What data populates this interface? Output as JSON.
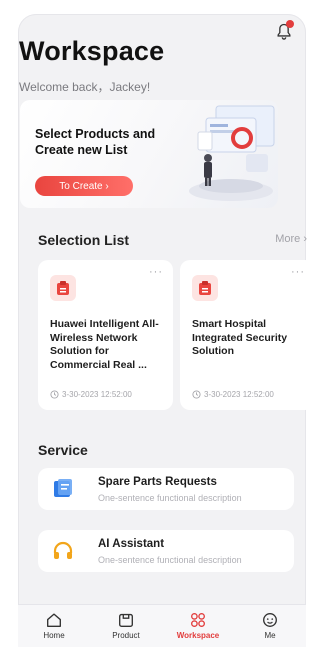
{
  "header": {
    "title": "Workspace",
    "subtitle": "Welcome back，Jackey!"
  },
  "hero": {
    "text": "Select Products and Create new List",
    "button_label": "To Create ›"
  },
  "selection": {
    "title": "Selection List",
    "more_label": "More ›",
    "cards": [
      {
        "title": "Huawei Intelligent All-Wireless Network Solution for Commercial Real ...",
        "time": "3-30-2023 12:52:00",
        "more": "···"
      },
      {
        "title": "Smart Hospital Integrated Security Solution",
        "time": "3-30-2023 12:52:00",
        "more": "···"
      }
    ]
  },
  "service": {
    "title": "Service",
    "items": [
      {
        "label": "Spare Parts Requests",
        "desc": "One-sentence functional description",
        "icon": "document-icon"
      },
      {
        "label": "AI Assistant",
        "desc": "One-sentence functional description",
        "icon": "headset-icon"
      }
    ]
  },
  "tabs": [
    {
      "label": "Home",
      "icon": "home-icon"
    },
    {
      "label": "Product",
      "icon": "product-icon"
    },
    {
      "label": "Workspace",
      "icon": "workspace-icon",
      "active": true
    },
    {
      "label": "Me",
      "icon": "me-icon"
    }
  ],
  "colors": {
    "accent": "#e23d3d",
    "card_icon_bg": "#fde4e2",
    "service_blue": "#2f7be6",
    "service_orange": "#f2a51a"
  }
}
